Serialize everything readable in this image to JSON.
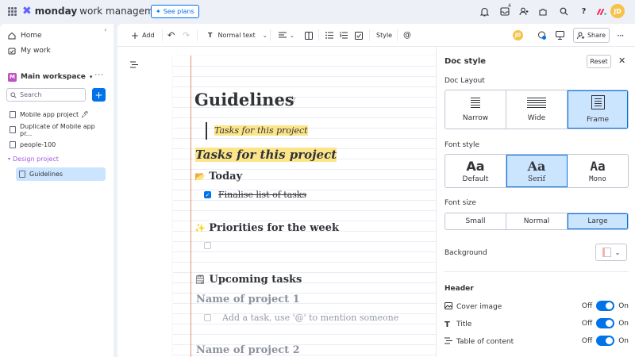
{
  "topbar": {
    "logo_bold": "monday",
    "logo_light": "work management",
    "see_plans": "See plans",
    "inbox_badge": "4",
    "avatar_initials": "JD"
  },
  "sidebar": {
    "nav": [
      {
        "label": "Home",
        "icon": "home-icon"
      },
      {
        "label": "My work",
        "icon": "my-work-icon"
      }
    ],
    "workspace": {
      "icon_letter": "M",
      "name": "Main workspace"
    },
    "search_placeholder": "Search",
    "items": [
      {
        "label": "Mobile app project 🖊"
      },
      {
        "label": "Duplicate of Mobile app pr..."
      },
      {
        "label": "people-100"
      }
    ],
    "folder": "Design project",
    "active_item": "Guidelines"
  },
  "toolbar": {
    "add": "Add",
    "text_style": "Normal text",
    "style": "Style",
    "mention": "@",
    "share": "Share",
    "avatar_initials": "JD",
    "updates_badge": "1"
  },
  "doc": {
    "title": "Guidelines",
    "quote": "Tasks for this project",
    "highlight_heading": "Tasks for this project",
    "sections": [
      {
        "emoji": "📂",
        "title": "Today"
      },
      {
        "emoji": "✨",
        "title": "Priorities for the week"
      },
      {
        "emoji": "🗒",
        "title": "Upcoming tasks"
      }
    ],
    "task_done": "Finalise list of tasks",
    "project1": "Name of project 1",
    "task_placeholder": "Add a task, use '@' to mention someone",
    "project2": "Name of project 2"
  },
  "panel": {
    "title": "Doc style",
    "reset": "Reset",
    "layout_label": "Doc Layout",
    "layouts": [
      "Narrow",
      "Wide",
      "Frame"
    ],
    "layout_selected": "Frame",
    "font_style_label": "Font style",
    "font_styles": [
      {
        "glyph": "Aa",
        "name": "Default"
      },
      {
        "glyph": "Aa",
        "name": "Serif"
      },
      {
        "glyph": "Aa",
        "name": "Mono"
      }
    ],
    "font_style_selected": "Serif",
    "font_size_label": "Font size",
    "font_sizes": [
      "Small",
      "Normal",
      "Large"
    ],
    "font_size_selected": "Large",
    "background_label": "Background",
    "header_label": "Header",
    "toggles": [
      {
        "label": "Cover image",
        "icon": "image-icon",
        "off": "Off",
        "on": "On",
        "value": true
      },
      {
        "label": "Title",
        "icon": "title-icon",
        "off": "Off",
        "on": "On",
        "value": true
      },
      {
        "label": "Table of content",
        "icon": "toc-icon",
        "off": "Off",
        "on": "On",
        "value": true
      }
    ]
  },
  "colors": {
    "accent": "#0073ea",
    "selected_bg": "#cce5ff",
    "highlight": "#fce589",
    "margin_line": "#e78f7f",
    "brand": "#6161ff"
  }
}
